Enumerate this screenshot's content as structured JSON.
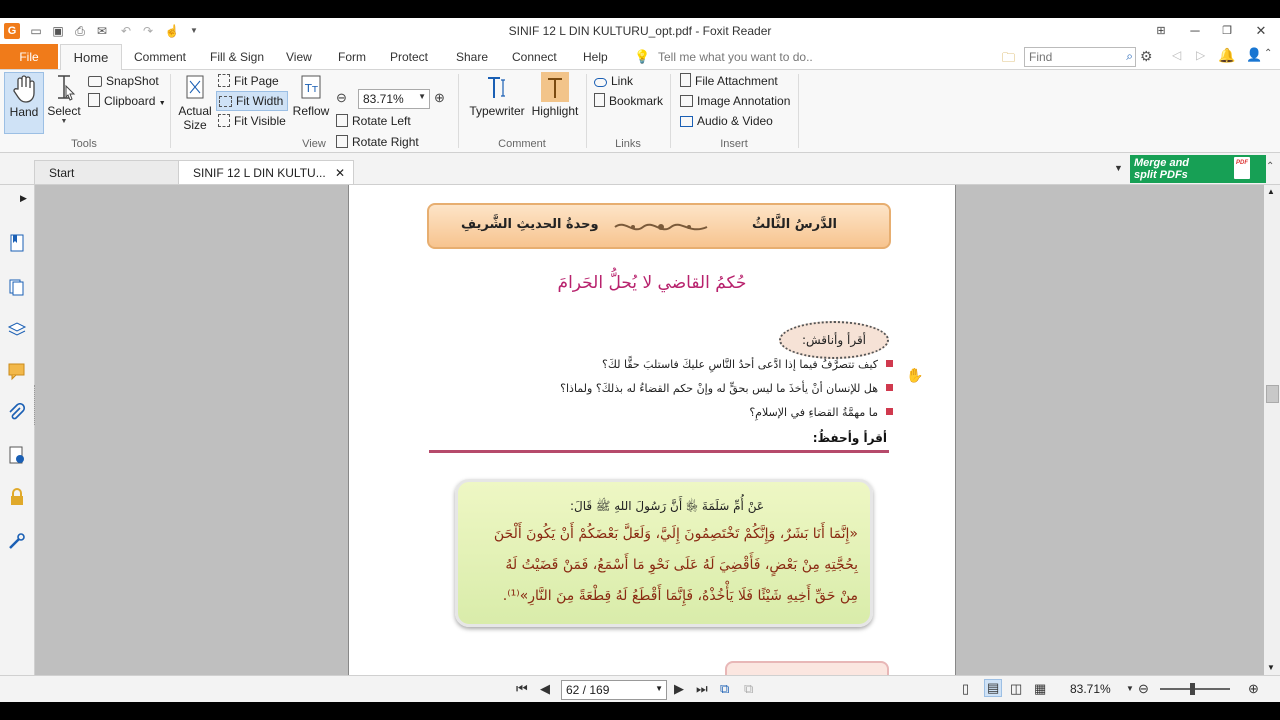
{
  "window": {
    "title": "SINIF 12 L DIN KULTURU_opt.pdf - Foxit Reader",
    "logo": "G"
  },
  "menu": {
    "file": "File",
    "tabs": [
      "Home",
      "Comment",
      "Fill & Sign",
      "View",
      "Form",
      "Protect",
      "Share",
      "Connect",
      "Help"
    ],
    "tell_me": "Tell me what you want to do..",
    "find_placeholder": "Find"
  },
  "ribbon": {
    "tools": {
      "hand": "Hand",
      "select": "Select",
      "snapshot": "SnapShot",
      "clipboard": "Clipboard",
      "label": "Tools"
    },
    "view": {
      "actual_size": "Actual Size",
      "fit_page": "Fit Page",
      "fit_width": "Fit Width",
      "fit_visible": "Fit Visible",
      "reflow": "Reflow",
      "zoom": "83.71%",
      "rotate_left": "Rotate Left",
      "rotate_right": "Rotate Right",
      "label": "View"
    },
    "comment": {
      "typewriter": "Typewriter",
      "highlight": "Highlight",
      "label": "Comment"
    },
    "links": {
      "link": "Link",
      "bookmark": "Bookmark",
      "label": "Links"
    },
    "insert": {
      "file_attachment": "File Attachment",
      "image_annotation": "Image Annotation",
      "audio_video": "Audio & Video",
      "label": "Insert"
    }
  },
  "tabs": {
    "start": "Start",
    "document": "SINIF 12 L DIN KULTU..."
  },
  "promo": {
    "line1": "Merge and",
    "line2": "split PDFs"
  },
  "page": {
    "lesson_number": "الدَّرسُ الثَّالثُ",
    "lesson_unit": "وحدةُ الحديثِ الشَّريفِ",
    "title": "حُكمُ القاضي لا يُحلُّ الحَرامَ",
    "read_discuss": "أقرأ وأناقش:",
    "questions": [
      "كيف تتصرَّفُ فيما إذا ادَّعى أحدُ النَّاسِ عليكَ فاستلبَ حقًّا لكَ؟",
      "هل للإنسان أنْ يأخذَ ما ليس بحقٍّ له وإنْ حكم القضاءُ له بذلكَ؟ ولماذا؟",
      "ما مهمَّةُ القضاءِ في الإسلامِ؟"
    ],
    "read_memorize": "أقرأ وأحفظُ:",
    "hadith_narrator": "عَنْ أُمِّ سَلَمَةَ ﵂ أَنَّ رَسُولَ اللهِ ﷺ قَالَ:",
    "hadith_lines": [
      "«إِنَّمَا أَنَا بَشَرٌ، وَإِنَّكُمْ تَخْتَصِمُونَ إِلَيَّ، وَلَعَلَّ بَعْضَكُمْ أَنْ يَكُونَ أَلْحَنَ",
      "بِحُجَّتِهِ مِنْ بَعْضٍ، فَأَقْضِيَ لَهُ عَلَى نَحْوِ مَا أَسْمَعُ، فَمَنْ قَضَيْتُ لَهُ",
      "مِنْ حَقِّ أَخِيهِ شَيْئًا فَلَا يَأْخُذْهُ، فَإِنَّمَا أَقْطَعُ لَهُ قِطْعَةً مِنَ النَّارِ»⁽¹⁾."
    ]
  },
  "status": {
    "page": "62 / 169",
    "zoom": "83.71%"
  },
  "colors": {
    "accent": "#f07b1a",
    "title_magenta": "#b8226d",
    "hadith_text": "#8a2a12",
    "promo_green": "#17a055"
  }
}
